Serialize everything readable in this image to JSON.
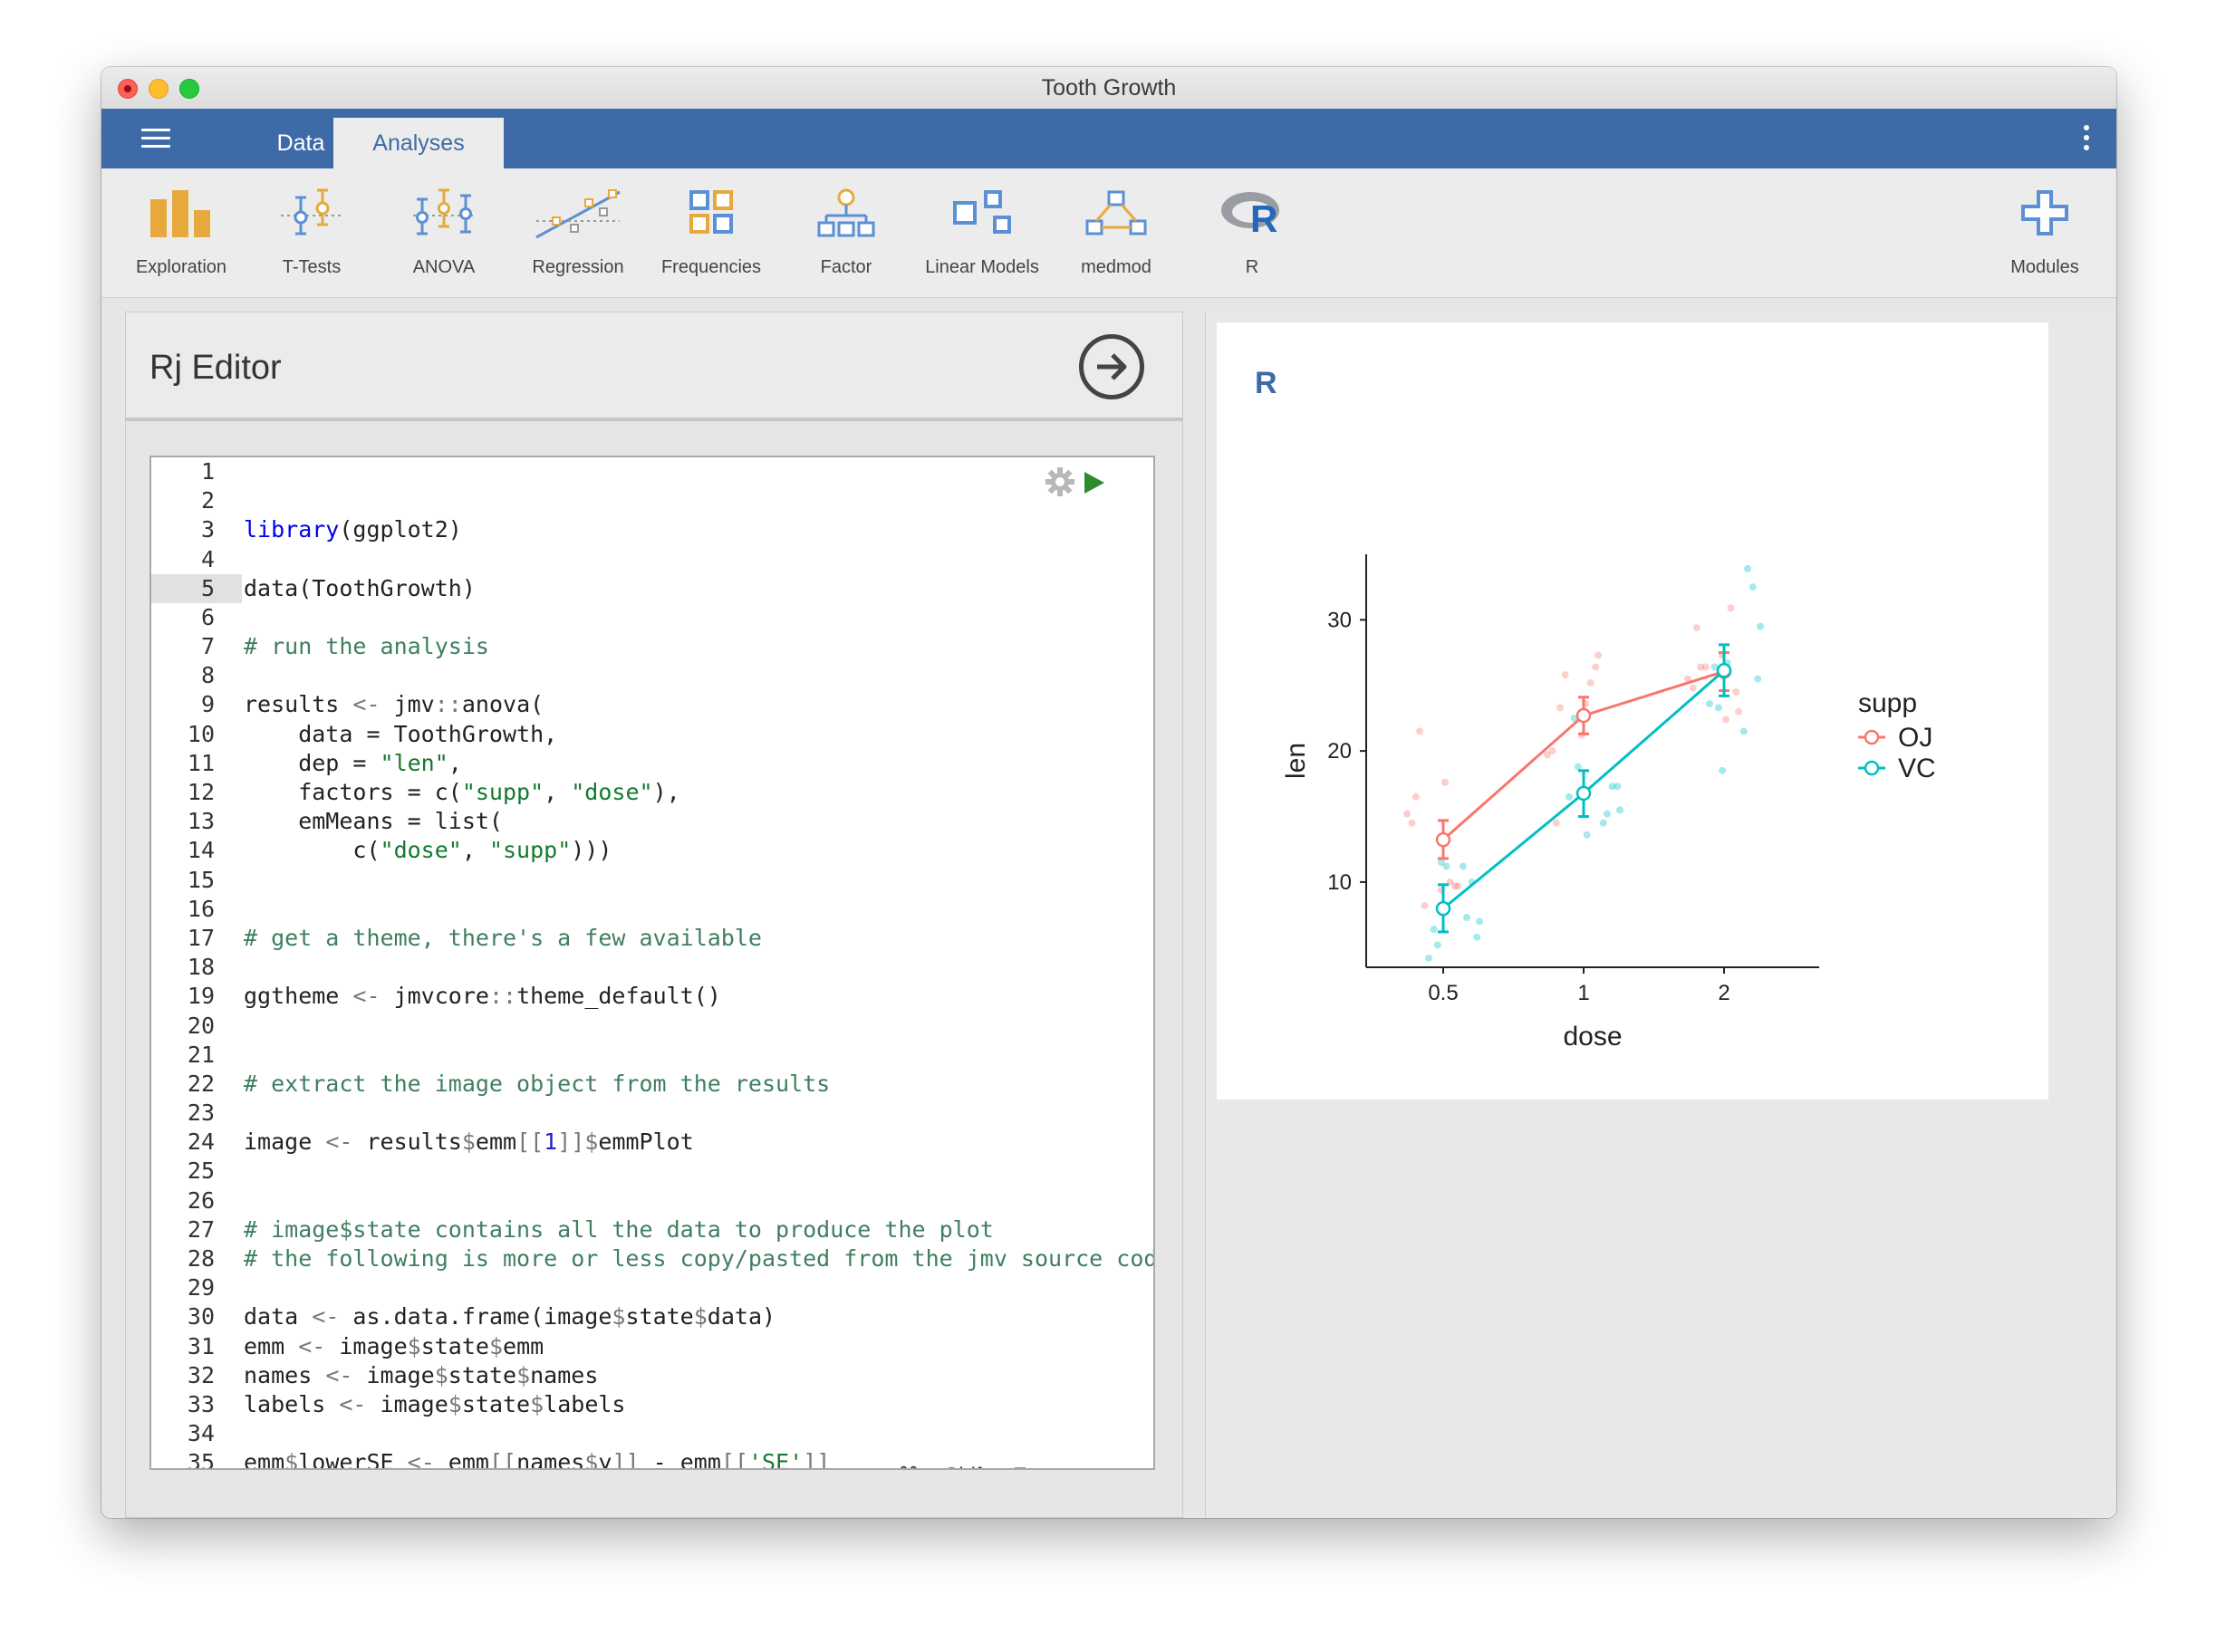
{
  "window": {
    "title": "Tooth Growth"
  },
  "nav": {
    "tabs": [
      {
        "label": "Data"
      },
      {
        "label": "Analyses"
      }
    ],
    "active_tab": "Analyses"
  },
  "ribbon": {
    "items": [
      {
        "label": "Exploration",
        "icon": "exploration-icon"
      },
      {
        "label": "T-Tests",
        "icon": "t-tests-icon"
      },
      {
        "label": "ANOVA",
        "icon": "anova-icon"
      },
      {
        "label": "Regression",
        "icon": "regression-icon"
      },
      {
        "label": "Frequencies",
        "icon": "frequencies-icon"
      },
      {
        "label": "Factor",
        "icon": "factor-icon"
      },
      {
        "label": "Linear Models",
        "icon": "linear-models-icon"
      },
      {
        "label": "medmod",
        "icon": "medmod-icon"
      },
      {
        "label": "R",
        "icon": "r-logo-icon"
      }
    ],
    "modules_label": "Modules"
  },
  "editor": {
    "title": "Rj Editor",
    "shortcut_hint": "⌘ + Shift + Enter to run",
    "current_line": 5,
    "lines": [
      "",
      "",
      "library(ggplot2)",
      "",
      "data(ToothGrowth)",
      "",
      "# run the analysis",
      "",
      "results <- jmv::anova(",
      "    data = ToothGrowth,",
      "    dep = \"len\",",
      "    factors = c(\"supp\", \"dose\"),",
      "    emMeans = list(",
      "        c(\"dose\", \"supp\")))",
      "",
      "",
      "# get a theme, there's a few available",
      "",
      "ggtheme <- jmvcore::theme_default()",
      "",
      "",
      "# extract the image object from the results",
      "",
      "image <- results$emm[[1]]$emmPlot",
      "",
      "",
      "# image$state contains all the data to produce the plot",
      "# the following is more or less copy/pasted from the jmv source code:",
      "",
      "data <- as.data.frame(image$state$data)",
      "emm <- image$state$emm",
      "names <- image$state$names",
      "labels <- image$state$labels",
      "",
      "emm$lowerSE <- emm[[names$y]] - emm[['SE']]"
    ]
  },
  "results": {
    "heading": "R"
  },
  "colors": {
    "accent": "#3e6ba8",
    "oj": "#f8766d",
    "vc": "#00bfc4",
    "analysis_orange": "#e8a93c",
    "analysis_blue": "#5b8fd6"
  },
  "chart_data": {
    "type": "line",
    "xlabel": "dose",
    "ylabel": "len",
    "categories": [
      "0.5",
      "1",
      "2"
    ],
    "yticks": [
      10,
      20,
      30
    ],
    "ylim": [
      3.5,
      35
    ],
    "legend_title": "supp",
    "legend_position": "right",
    "grid": false,
    "series": [
      {
        "name": "OJ",
        "color": "#f8766d",
        "means": [
          13.23,
          22.7,
          26.06
        ],
        "se_lower": [
          11.8,
          21.3,
          24.6
        ],
        "se_upper": [
          14.7,
          24.1,
          27.5
        ],
        "points": [
          [
            0.5,
            15.2
          ],
          [
            0.5,
            21.5
          ],
          [
            0.5,
            17.6
          ],
          [
            0.5,
            9.7
          ],
          [
            0.5,
            14.5
          ],
          [
            0.5,
            10.0
          ],
          [
            0.5,
            8.2
          ],
          [
            0.5,
            9.4
          ],
          [
            0.5,
            16.5
          ],
          [
            0.5,
            9.7
          ],
          [
            1,
            19.7
          ],
          [
            1,
            23.3
          ],
          [
            1,
            23.6
          ],
          [
            1,
            26.4
          ],
          [
            1,
            20.0
          ],
          [
            1,
            25.2
          ],
          [
            1,
            25.8
          ],
          [
            1,
            21.2
          ],
          [
            1,
            14.5
          ],
          [
            1,
            27.3
          ],
          [
            2,
            25.5
          ],
          [
            2,
            26.4
          ],
          [
            2,
            22.4
          ],
          [
            2,
            24.5
          ],
          [
            2,
            24.8
          ],
          [
            2,
            30.9
          ],
          [
            2,
            26.4
          ],
          [
            2,
            27.3
          ],
          [
            2,
            29.4
          ],
          [
            2,
            23.0
          ]
        ]
      },
      {
        "name": "VC",
        "color": "#00bfc4",
        "means": [
          7.98,
          16.77,
          26.14
        ],
        "se_lower": [
          6.2,
          15.0,
          24.2
        ],
        "se_upper": [
          9.8,
          18.5,
          28.1
        ],
        "points": [
          [
            0.5,
            4.2
          ],
          [
            0.5,
            11.5
          ],
          [
            0.5,
            7.3
          ],
          [
            0.5,
            5.8
          ],
          [
            0.5,
            6.4
          ],
          [
            0.5,
            10.0
          ],
          [
            0.5,
            11.2
          ],
          [
            0.5,
            11.2
          ],
          [
            0.5,
            5.2
          ],
          [
            0.5,
            7.0
          ],
          [
            1,
            16.5
          ],
          [
            1,
            16.5
          ],
          [
            1,
            15.2
          ],
          [
            1,
            17.3
          ],
          [
            1,
            22.5
          ],
          [
            1,
            17.3
          ],
          [
            1,
            13.6
          ],
          [
            1,
            14.5
          ],
          [
            1,
            18.8
          ],
          [
            1,
            15.5
          ],
          [
            2,
            23.6
          ],
          [
            2,
            18.5
          ],
          [
            2,
            33.9
          ],
          [
            2,
            25.5
          ],
          [
            2,
            26.4
          ],
          [
            2,
            32.5
          ],
          [
            2,
            26.7
          ],
          [
            2,
            21.5
          ],
          [
            2,
            23.3
          ],
          [
            2,
            29.5
          ]
        ]
      }
    ]
  }
}
